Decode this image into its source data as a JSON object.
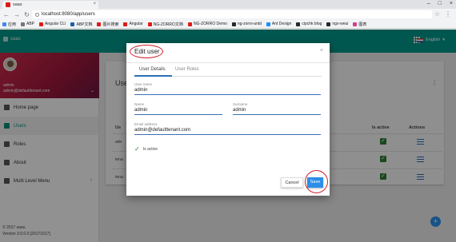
{
  "browser": {
    "tab_title": "saas",
    "url": "localhost:8080/app/users",
    "bookmarks": [
      {
        "label": "应用",
        "color": "#4285f4",
        "icon": "apps-icon"
      },
      {
        "label": "ABP",
        "color": "#777777",
        "icon": "folder-icon"
      },
      {
        "label": "Angular CLI",
        "color": "#dd1b16",
        "icon": "angular-icon"
      },
      {
        "label": "ABP文档",
        "color": "#1c5fa8",
        "icon": "abp-icon"
      },
      {
        "label": "图片搜索",
        "color": "#dd1b16",
        "icon": "image-icon"
      },
      {
        "label": "Angular",
        "color": "#dd1b16",
        "icon": "angular-icon"
      },
      {
        "label": "NG-ZORRO文档",
        "color": "#dd1b16",
        "icon": "zorro-icon"
      },
      {
        "label": "NG-ZORRO Demo",
        "color": "#dd1b16",
        "icon": "zorro-icon"
      },
      {
        "label": "ng-zorro-antd",
        "color": "#24292e",
        "icon": "github-icon"
      },
      {
        "label": "Ant Design",
        "color": "#1890ff",
        "icon": "antd-icon"
      },
      {
        "label": "cipchk blog",
        "color": "#24292e",
        "icon": "github-icon"
      },
      {
        "label": "ngx-weui",
        "color": "#24292e",
        "icon": "github-icon"
      },
      {
        "label": "图表",
        "color": "#d23f8b",
        "icon": "chart-icon"
      }
    ]
  },
  "app": {
    "brand": "saas",
    "language": "English",
    "user_name": "admin",
    "user_email": "admin@defaulttenant.com",
    "menu": [
      {
        "label": "Home page",
        "icon": "home-icon",
        "active": false
      },
      {
        "label": "Users",
        "icon": "users-icon",
        "active": true
      },
      {
        "label": "Roles",
        "icon": "tag-icon",
        "active": false
      },
      {
        "label": "About",
        "icon": "info-icon",
        "active": false
      },
      {
        "label": "Multi Level Menu",
        "icon": "menu-icon",
        "active": false
      }
    ],
    "footer_copyright": "© 2017 saas.",
    "footer_version": "Version 3.0.0.0 [20171017]",
    "card_title": "Use",
    "table": {
      "col_name_head": "Us",
      "col_active": "Is active",
      "col_actions": "Actions",
      "rows": [
        "adn",
        "tena",
        "tena"
      ]
    },
    "fab_label": "+"
  },
  "modal": {
    "title": "Edit user",
    "tabs": [
      "User Details",
      "User Roles"
    ],
    "fields": {
      "username_label": "User name",
      "username_value": "admin",
      "name_label": "Name",
      "name_value": "admin",
      "surname_label": "Surname",
      "surname_value": "admin",
      "email_label": "Email address",
      "email_value": "admin@defaulttenant.com"
    },
    "is_active_label": "Is active",
    "is_active_checked": true,
    "cancel_label": "Cancel",
    "save_label": "Save",
    "annotation_color": "#d0232a"
  }
}
